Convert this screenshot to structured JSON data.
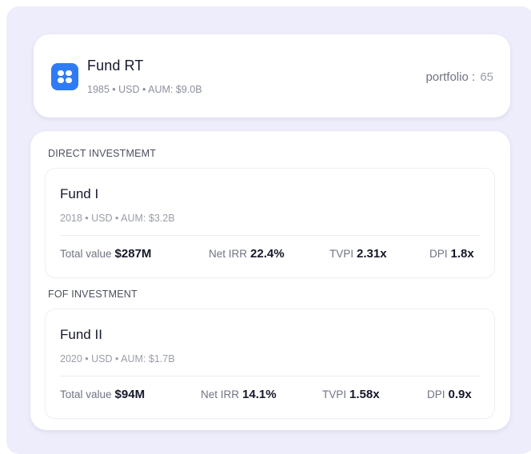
{
  "header": {
    "title": "Fund RT",
    "meta": "1985 • USD • AUM: $9.0B",
    "portfolio_label": "portfolio :",
    "portfolio_count": "65",
    "icon": "grid-apps-icon",
    "accent_color": "#2f7bf6"
  },
  "sections": [
    {
      "label": "DIRECT INVESTMEMT",
      "fund": {
        "name": "Fund I",
        "meta": "2018 • USD • AUM:  $3.2B",
        "metrics": {
          "total_value_label": "Total value",
          "total_value": "$287M",
          "net_irr_label": "Net IRR",
          "net_irr": "22.4%",
          "tvpi_label": "TVPI",
          "tvpi": "2.31x",
          "dpi_label": "DPI",
          "dpi": "1.8x"
        }
      }
    },
    {
      "label": "FOF INVESTMENT",
      "fund": {
        "name": "Fund II",
        "meta": "2020 • USD • AUM:  $1.7B",
        "metrics": {
          "total_value_label": "Total value",
          "total_value": "$94M",
          "net_irr_label": "Net IRR",
          "net_irr": "14.1%",
          "tvpi_label": "TVPI",
          "tvpi": "1.58x",
          "dpi_label": "DPI",
          "dpi": "0.9x"
        }
      }
    }
  ]
}
